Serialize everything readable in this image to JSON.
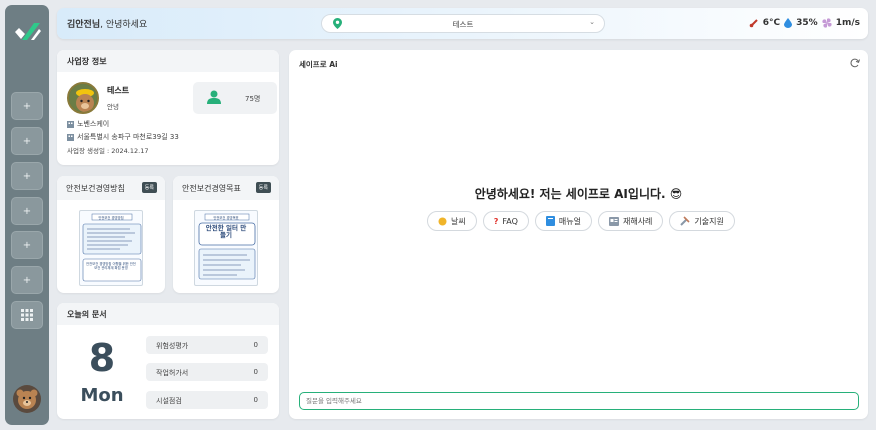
{
  "sidebar": {
    "items": [
      {
        "icon": "plus-icon",
        "glyph": "+"
      },
      {
        "icon": "plus-icon",
        "glyph": "+"
      },
      {
        "icon": "plus-icon",
        "glyph": "+"
      },
      {
        "icon": "plus-icon",
        "glyph": "+"
      },
      {
        "icon": "plus-icon",
        "glyph": "+"
      },
      {
        "icon": "plus-icon",
        "glyph": "+"
      },
      {
        "icon": "grid-icon",
        "glyph": "⋮⋮⋮"
      }
    ]
  },
  "header": {
    "greeting_name": "김안전님",
    "greeting_rest": ", 안녕하세요",
    "site_select_value": "테스트",
    "weather": {
      "temp": "6°C",
      "humidity": "35%",
      "wind": "1m/s"
    }
  },
  "site_info": {
    "title": "사업장 정보",
    "name": "테스트",
    "role": "안녕",
    "worker_count": "75명",
    "company": "노벤스케이",
    "address": "서울특별시 송파구 마천로39길 33",
    "created": "사업장 생성일 : 2024.12.17"
  },
  "policy_card": {
    "title": "안전보건경영방침",
    "tag": "등록",
    "poster_title": "안전보건 경영방침",
    "poster_footer": "안전보건 경영방침 이행을 위한 안전보건 관리체계 확립 운영"
  },
  "goal_card": {
    "title": "안전보건경영목표",
    "tag": "등록",
    "poster_title": "안전보건 경영목표",
    "poster_headline": "안전한 일터 만들기"
  },
  "docs": {
    "title": "오늘의 문서",
    "day": "8",
    "weekday": "Mon",
    "rows": [
      {
        "label": "위험성평가",
        "count": "0"
      },
      {
        "label": "작업허가서",
        "count": "0"
      },
      {
        "label": "시설점검",
        "count": "0"
      }
    ]
  },
  "chat": {
    "title": "세이프로 Ai",
    "welcome": "안녕하세요! 저는 세이프로 AI입니다.",
    "welcome_emoji": "😎",
    "chips": [
      {
        "icon": "sun-icon",
        "label": "날씨"
      },
      {
        "icon": "question-icon",
        "label": "FAQ"
      },
      {
        "icon": "book-icon",
        "label": "매뉴얼"
      },
      {
        "icon": "newspaper-icon",
        "label": "재해사례"
      },
      {
        "icon": "tools-icon",
        "label": "기술지원"
      }
    ],
    "input_placeholder": "질문을 입력해주세요"
  },
  "colors": {
    "accent_green": "#27b07a",
    "rail": "#6e7e84",
    "tag": "#3f4e54"
  }
}
